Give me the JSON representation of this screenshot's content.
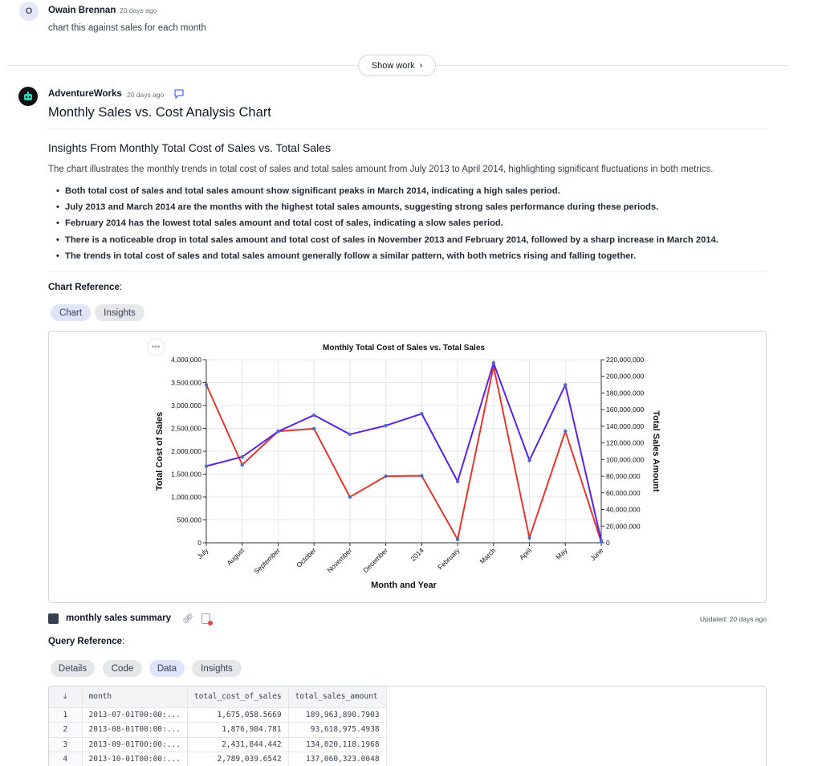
{
  "user_message": {
    "avatar_initial": "O",
    "name": "Owain Brennan",
    "time": "20 days ago",
    "text": "chart this against sales for each month"
  },
  "show_work_label": "Show work",
  "bot": {
    "name": "AdventureWorks",
    "time": "20 days ago",
    "title": "Monthly Sales vs. Cost Analysis Chart"
  },
  "insights": {
    "heading": "Insights From Monthly Total Cost of Sales vs. Total Sales",
    "intro": "The chart illustrates the monthly trends in total cost of sales and total sales amount from July 2013 to April 2014, highlighting significant fluctuations in both metrics.",
    "bullets": [
      "Both total cost of sales and total sales amount show significant peaks in March 2014, indicating a high sales period.",
      "July 2013 and March 2014 are the months with the highest total sales amounts, suggesting strong sales performance during these periods.",
      "February 2014 has the lowest total sales amount and total cost of sales, indicating a slow sales period.",
      "There is a noticeable drop in total sales amount and total cost of sales in November 2013 and February 2014, followed by a sharp increase in March 2014.",
      "The trends in total cost of sales and total sales amount generally follow a similar pattern, with both metrics rising and falling together."
    ]
  },
  "chart_reference": {
    "label": "Chart Reference",
    "tabs": [
      "Chart",
      "Insights"
    ],
    "active_tab": "Chart"
  },
  "chart_data": {
    "type": "line",
    "title": "Monthly Total Cost of Sales vs. Total Sales",
    "xlabel": "Month and Year",
    "ylabel": "Total Cost of Sales",
    "y2label": "Total Sales Amount",
    "categories": [
      "July",
      "August",
      "September",
      "October",
      "November",
      "December",
      "2014",
      "February",
      "March",
      "April",
      "May",
      "June"
    ],
    "ylim": [
      0,
      4000000
    ],
    "y2lim": [
      0,
      220000000
    ],
    "yticks": [
      "0",
      "500,000",
      "1,000,000",
      "1,500,000",
      "2,000,000",
      "2,500,000",
      "3,000,000",
      "3,500,000",
      "4,000,000"
    ],
    "y2ticks": [
      "0",
      "20,000,000",
      "40,000,000",
      "60,000,000",
      "80,000,000",
      "100,000,000",
      "120,000,000",
      "140,000,000",
      "160,000,000",
      "180,000,000",
      "200,000,000",
      "220,000,000"
    ],
    "series": [
      {
        "name": "Total Cost of Sales",
        "axis": "left",
        "color": "#5b21e6",
        "values": [
          1675058.5669,
          1876984.781,
          2431844.442,
          2789039.6542,
          2370000,
          2560000,
          2820000,
          1340000,
          3930000,
          1800000,
          3450000,
          50000
        ]
      },
      {
        "name": "Total Sales Amount",
        "axis": "right",
        "color": "#e0382e",
        "values": [
          189963890.7903,
          93618975.4938,
          134020118.1968,
          137060323.0048,
          55000000,
          80000000,
          80500000,
          4000000,
          212000000,
          6000000,
          134000000,
          1000000
        ]
      }
    ]
  },
  "summary": {
    "name": "monthly sales summary",
    "updated": "Updated: 20 days ago"
  },
  "query_reference": {
    "label": "Query Reference",
    "tabs": [
      "Details",
      "Code",
      "Data",
      "Insights"
    ],
    "active_tab": "Data"
  },
  "table": {
    "columns": [
      "month",
      "total_cost_of_sales",
      "total_sales_amount"
    ],
    "rows": [
      {
        "idx": "1",
        "month": "2013-07-01T00:00:...",
        "cost": "1,675,058.5669",
        "sales": "189,963,890.7903"
      },
      {
        "idx": "2",
        "month": "2013-08-01T00:00:...",
        "cost": "1,876,984.781",
        "sales": "93,618,975.4938"
      },
      {
        "idx": "3",
        "month": "2013-09-01T00:00:...",
        "cost": "2,431,844.442",
        "sales": "134,020,118.1968"
      },
      {
        "idx": "4",
        "month": "2013-10-01T00:00:...",
        "cost": "2,789,039.6542",
        "sales": "137,060,323.0048"
      }
    ]
  }
}
